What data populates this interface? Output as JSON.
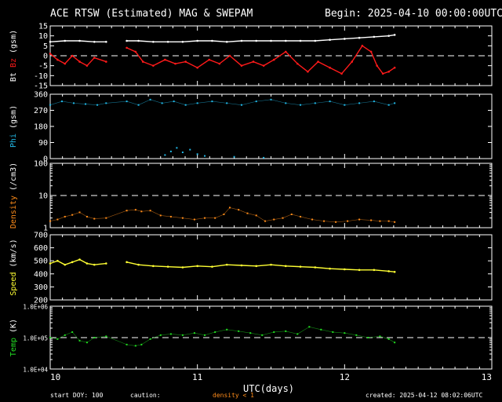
{
  "header": {
    "title": "ACE RTSW (Estimated) MAG & SWEPAM",
    "begin": "Begin: 2025-04-10 00:00:00UTC"
  },
  "footer": {
    "start_doy": "start DOY: 100",
    "caution": "caution:",
    "density_note": "density < 1",
    "created": "created: 2025-04-12 08:02:06UTC"
  },
  "colors": {
    "bt": "#ffffff",
    "bz": "#ff1a1a",
    "phi": "#22b8e6",
    "density": "#ff8c1a",
    "speed": "#ffff33",
    "temp": "#22dd22",
    "axis": "#ffffff",
    "dashed": "#ffffff"
  },
  "chart_data": {
    "type": "line",
    "xlabel": "UTC(days)",
    "x_ticks": [
      "10",
      "11",
      "12",
      "13"
    ],
    "x_range": [
      10,
      13
    ],
    "panels": [
      {
        "id": "mag",
        "type": "line",
        "ylabel_parts": [
          {
            "text": "Bt",
            "color": "#ffffff"
          },
          {
            "text": "Bz",
            "color": "#ff1a1a"
          },
          {
            "text": "(gsm)",
            "color": "#ffffff"
          }
        ],
        "ylim": [
          -15,
          15
        ],
        "y_ticks": [
          "15",
          "10",
          "5",
          "0",
          "-5",
          "-10",
          "-15"
        ],
        "reference_line": 0,
        "gaps": [
          [
            10.38,
            10.52
          ]
        ],
        "series": [
          {
            "name": "Bt",
            "color": "#ffffff",
            "x": [
              10.0,
              10.1,
              10.2,
              10.3,
              10.38,
              10.52,
              10.6,
              10.7,
              10.8,
              10.9,
              11.0,
              11.1,
              11.2,
              11.3,
              11.4,
              11.5,
              11.6,
              11.7,
              11.8,
              11.9,
              12.0,
              12.1,
              12.2,
              12.3,
              12.34
            ],
            "y": [
              7,
              7.5,
              7.5,
              7,
              7,
              7.5,
              7.5,
              7,
              7,
              7,
              7.5,
              7.5,
              7,
              7.5,
              7.5,
              7.5,
              7.5,
              7.5,
              7.5,
              8,
              8.5,
              9,
              9.5,
              10,
              10.5
            ]
          },
          {
            "name": "Bz",
            "color": "#ff1a1a",
            "x": [
              10.0,
              10.05,
              10.1,
              10.15,
              10.2,
              10.25,
              10.3,
              10.38,
              10.52,
              10.58,
              10.63,
              10.7,
              10.78,
              10.85,
              10.92,
              11.0,
              11.08,
              11.15,
              11.22,
              11.3,
              11.38,
              11.45,
              11.52,
              11.6,
              11.68,
              11.75,
              11.82,
              11.9,
              11.98,
              12.05,
              12.12,
              12.18,
              12.22,
              12.26,
              12.3,
              12.34
            ],
            "y": [
              1,
              -2,
              -4,
              0,
              -3,
              -5,
              -1,
              -3,
              4,
              2,
              -3,
              -5,
              -2,
              -4,
              -3,
              -6,
              -2,
              -4,
              0,
              -5,
              -3,
              -5,
              -2,
              2,
              -4,
              -8,
              -3,
              -6,
              -9,
              -3,
              5,
              2,
              -5,
              -9,
              -8,
              -6
            ]
          }
        ]
      },
      {
        "id": "phi",
        "type": "scatter",
        "ylabel_parts": [
          {
            "text": "Phi",
            "color": "#22b8e6"
          },
          {
            "text": "(gsm)",
            "color": "#ffffff"
          }
        ],
        "ylim": [
          0,
          360
        ],
        "y_ticks": [
          "360",
          "270",
          "180",
          "90",
          "0"
        ],
        "gaps": [
          [
            10.38,
            10.52
          ]
        ],
        "series": [
          {
            "name": "Phi",
            "color": "#22b8e6",
            "x": [
              10.0,
              10.08,
              10.16,
              10.24,
              10.32,
              10.38,
              10.52,
              10.6,
              10.68,
              10.76,
              10.84,
              10.92,
              11.0,
              11.1,
              11.2,
              11.3,
              11.4,
              11.5,
              11.6,
              11.7,
              11.8,
              11.9,
              12.0,
              12.1,
              12.2,
              12.3,
              12.34
            ],
            "y": [
              300,
              320,
              310,
              305,
              300,
              310,
              320,
              300,
              330,
              310,
              320,
              300,
              310,
              320,
              310,
              300,
              320,
              330,
              310,
              300,
              310,
              320,
              300,
              310,
              320,
              300,
              310
            ],
            "extra_x": [
              10.78,
              10.82,
              10.86,
              10.9,
              10.95,
              11.0,
              11.05,
              11.25,
              11.45
            ],
            "extra_y": [
              20,
              40,
              60,
              35,
              50,
              25,
              15,
              10,
              5
            ]
          }
        ]
      },
      {
        "id": "density",
        "type": "scatter",
        "ylabel_parts": [
          {
            "text": "Density",
            "color": "#ff8c1a"
          },
          {
            "text": "(/cm3)",
            "color": "#ffffff"
          }
        ],
        "ylim": [
          1,
          100
        ],
        "y_scale": "log",
        "y_ticks": [
          "100",
          "10",
          "1"
        ],
        "reference_line": 10,
        "gaps": [
          [
            10.38,
            10.52
          ]
        ],
        "series": [
          {
            "name": "Density",
            "color": "#ff8c1a",
            "x": [
              10.0,
              10.05,
              10.1,
              10.15,
              10.2,
              10.25,
              10.3,
              10.38,
              10.52,
              10.58,
              10.62,
              10.68,
              10.75,
              10.82,
              10.9,
              10.98,
              11.05,
              11.12,
              11.18,
              11.22,
              11.28,
              11.34,
              11.4,
              11.46,
              11.52,
              11.58,
              11.64,
              11.7,
              11.78,
              11.86,
              11.94,
              12.02,
              12.1,
              12.18,
              12.24,
              12.3,
              12.34
            ],
            "y": [
              1.6,
              1.8,
              2.2,
              2.5,
              3.0,
              2.2,
              1.9,
              2.0,
              3.4,
              3.6,
              3.2,
              3.4,
              2.4,
              2.2,
              2.0,
              1.8,
              2.0,
              2.0,
              2.6,
              4.2,
              3.6,
              2.8,
              2.4,
              1.6,
              1.8,
              2.0,
              2.6,
              2.2,
              1.8,
              1.6,
              1.5,
              1.6,
              1.8,
              1.7,
              1.6,
              1.6,
              1.5
            ]
          }
        ]
      },
      {
        "id": "speed",
        "type": "line",
        "ylabel_parts": [
          {
            "text": "Speed",
            "color": "#ffff33"
          },
          {
            "text": "(km/s)",
            "color": "#ffffff"
          }
        ],
        "ylim": [
          200,
          700
        ],
        "y_ticks": [
          "700",
          "600",
          "500",
          "400",
          "300",
          "200"
        ],
        "gaps": [
          [
            10.38,
            10.52
          ]
        ],
        "series": [
          {
            "name": "Speed",
            "color": "#ffff33",
            "x": [
              10.0,
              10.05,
              10.1,
              10.15,
              10.2,
              10.25,
              10.3,
              10.38,
              10.52,
              10.6,
              10.7,
              10.8,
              10.9,
              11.0,
              11.1,
              11.2,
              11.3,
              11.4,
              11.5,
              11.6,
              11.7,
              11.8,
              11.9,
              12.0,
              12.1,
              12.2,
              12.3,
              12.34
            ],
            "y": [
              480,
              500,
              470,
              490,
              510,
              480,
              470,
              480,
              490,
              470,
              460,
              455,
              450,
              460,
              455,
              470,
              465,
              460,
              470,
              460,
              455,
              450,
              440,
              435,
              430,
              430,
              420,
              415
            ]
          }
        ]
      },
      {
        "id": "temp",
        "type": "scatter",
        "ylabel_parts": [
          {
            "text": "Temp",
            "color": "#22dd22"
          },
          {
            "text": "(K)",
            "color": "#ffffff"
          }
        ],
        "ylim": [
          10000,
          1000000
        ],
        "y_scale": "log",
        "y_ticks": [
          "1.0E+06",
          "1.0E+05",
          "1.0E+04"
        ],
        "reference_line": 100000,
        "gaps": [
          [
            10.38,
            10.52
          ]
        ],
        "series": [
          {
            "name": "Temp",
            "color": "#22dd22",
            "x": [
              10.0,
              10.05,
              10.1,
              10.15,
              10.2,
              10.25,
              10.3,
              10.38,
              10.52,
              10.58,
              10.62,
              10.68,
              10.75,
              10.82,
              10.9,
              10.98,
              11.05,
              11.12,
              11.2,
              11.28,
              11.36,
              11.44,
              11.52,
              11.6,
              11.68,
              11.76,
              11.84,
              11.92,
              12.0,
              12.08,
              12.16,
              12.24,
              12.3,
              12.34
            ],
            "y": [
              100000,
              90000,
              120000,
              150000,
              80000,
              70000,
              100000,
              110000,
              60000,
              55000,
              60000,
              90000,
              120000,
              130000,
              120000,
              140000,
              120000,
              150000,
              180000,
              160000,
              140000,
              120000,
              150000,
              160000,
              130000,
              220000,
              180000,
              150000,
              140000,
              120000,
              100000,
              110000,
              90000,
              70000
            ]
          }
        ]
      }
    ]
  }
}
